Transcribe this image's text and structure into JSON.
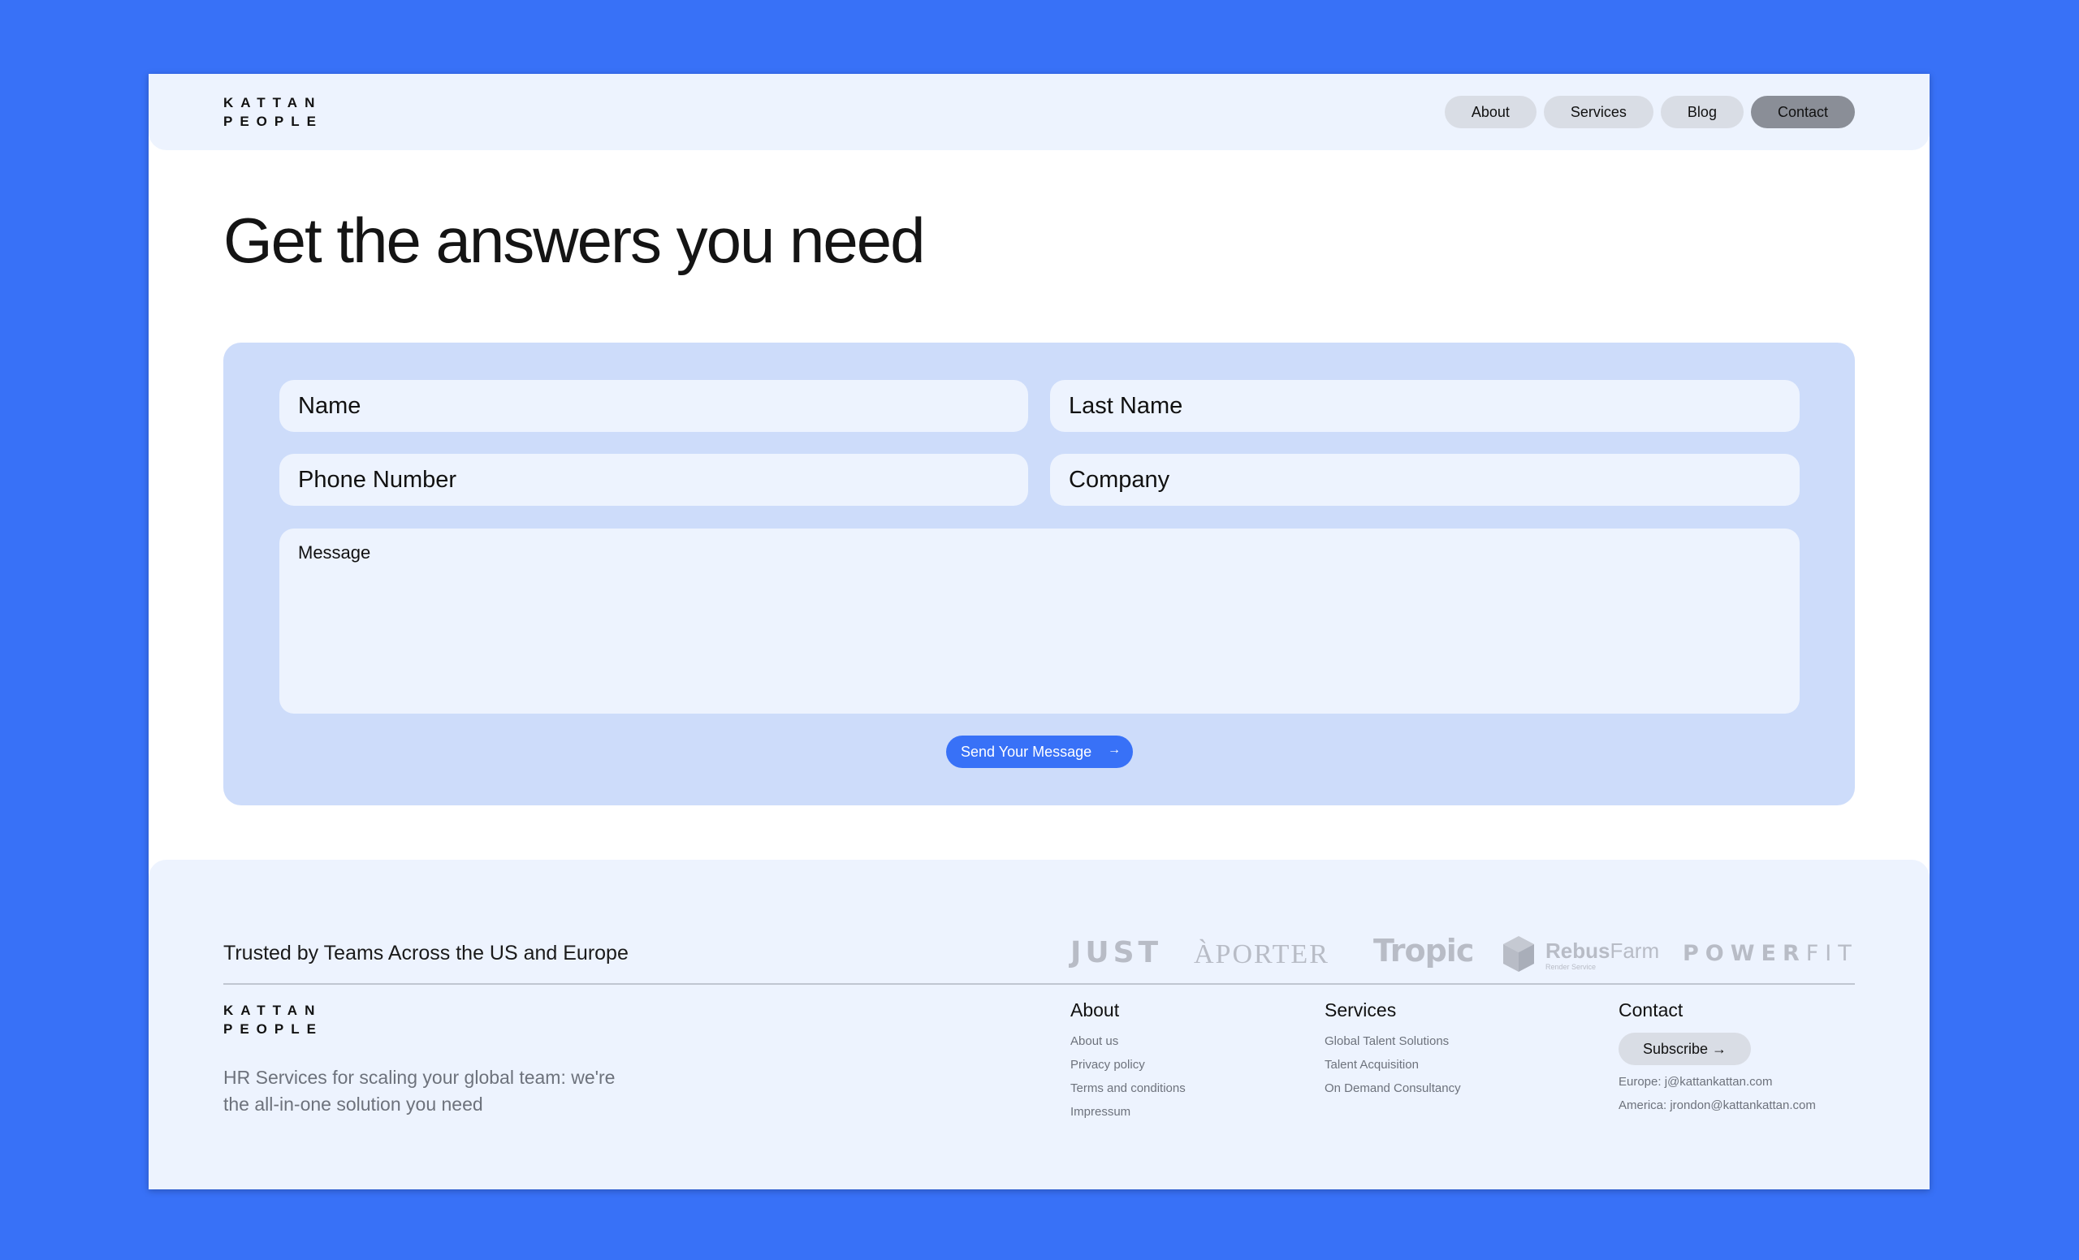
{
  "header": {
    "logo_line1": "KATTAN",
    "logo_line2": "PEOPLE",
    "nav": [
      {
        "label": "About"
      },
      {
        "label": "Services"
      },
      {
        "label": "Blog"
      },
      {
        "label": "Contact",
        "active": true
      }
    ]
  },
  "hero": {
    "title": "Get the answers you need"
  },
  "form": {
    "name_placeholder": "Name",
    "last_name_placeholder": "Last Name",
    "phone_placeholder": "Phone Number",
    "company_placeholder": "Company",
    "message_placeholder": "Message",
    "send_label": "Send Your Message",
    "send_icon": "→"
  },
  "footer": {
    "trusted": "Trusted by Teams Across the US and Europe",
    "brands": {
      "just": "JUST",
      "aporter": "ÀPORTER",
      "tropic": "Tropic",
      "rebus_bold": "Rebus",
      "rebus_light": "Farm",
      "rebus_sub": "Render Service",
      "power": "POWER",
      "fit": "FIT"
    },
    "logo_line1": "KATTAN",
    "logo_line2": "PEOPLE",
    "tagline": "HR Services for scaling your global team: we're the all-in-one solution you need",
    "about": {
      "heading": "About",
      "links": [
        "About us",
        "Privacy policy",
        "Terms and conditions",
        "Impressum"
      ]
    },
    "services": {
      "heading": "Services",
      "links": [
        "Global Talent Solutions",
        "Talent Acquisition",
        "On Demand Consultancy"
      ]
    },
    "contact": {
      "heading": "Contact",
      "subscribe_label": "Subscribe →",
      "europe": "Europe: j@kattankattan.com",
      "america": "America: jrondon@kattankattan.com"
    }
  },
  "colors": {
    "background": "#3871f7",
    "accent": "#3871f7",
    "form_card": "#cddcfa",
    "panel": "#edf3fe"
  }
}
